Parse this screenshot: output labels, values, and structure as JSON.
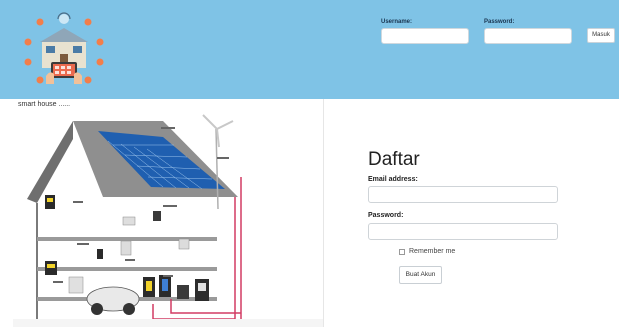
{
  "header": {
    "username_label": "Username:",
    "password_label": "Password:",
    "username_value": "",
    "password_value": "",
    "login_button": "Masuk",
    "brand_color": "#7fc3e6"
  },
  "left": {
    "caption": "smart house ......",
    "image_icon": "smart-house-solar-diagram"
  },
  "form": {
    "title": "Daftar",
    "email_label": "Email address:",
    "email_value": "",
    "password_label": "Password:",
    "password_value": "",
    "remember_label": "Remember me",
    "remember_checked": false,
    "submit_label": "Buat Akun"
  }
}
